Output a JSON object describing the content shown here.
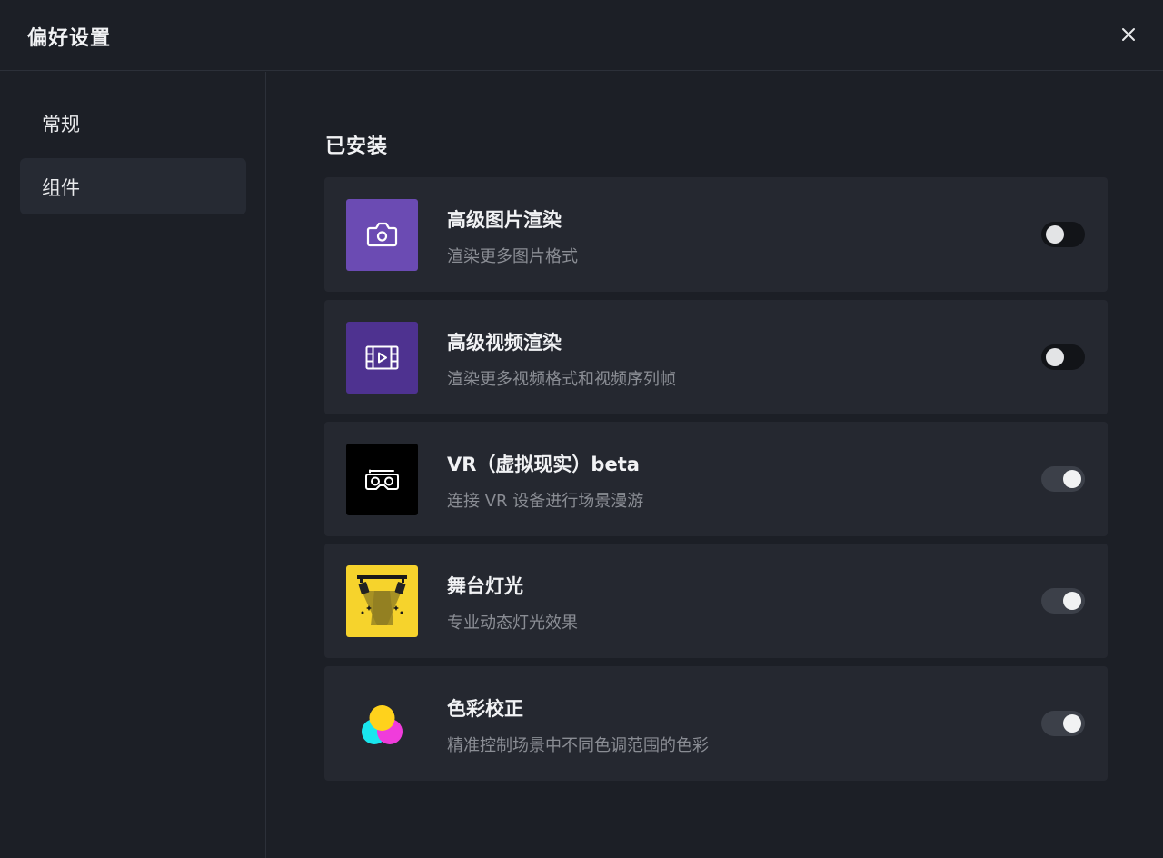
{
  "dialog": {
    "title": "偏好设置",
    "close_icon": "close-icon"
  },
  "sidebar": {
    "items": [
      {
        "label": "常规",
        "active": false
      },
      {
        "label": "组件",
        "active": true
      }
    ]
  },
  "main": {
    "section_title": "已安装",
    "plugins": [
      {
        "name": "高级图片渲染",
        "description": "渲染更多图片格式",
        "icon": "camera-icon",
        "icon_bg": "#6b4bb3",
        "enabled": false
      },
      {
        "name": "高级视频渲染",
        "description": "渲染更多视频格式和视频序列帧",
        "icon": "video-film-icon",
        "icon_bg": "#4e3290",
        "enabled": false
      },
      {
        "name": "VR（虚拟现实）beta",
        "description": "连接 VR 设备进行场景漫游",
        "icon": "vr-headset-icon",
        "icon_bg": "#000000",
        "enabled": true
      },
      {
        "name": "舞台灯光",
        "description": "专业动态灯光效果",
        "icon": "stage-light-icon",
        "icon_bg": "#f6d32c",
        "enabled": true
      },
      {
        "name": "色彩校正",
        "description": "精准控制场景中不同色调范围的色彩",
        "icon": "color-circles-icon",
        "icon_bg": "#252830",
        "enabled": true
      }
    ]
  },
  "colors": {
    "background": "#1c1f26",
    "card": "#252830",
    "toggle_off": "#121418",
    "toggle_on": "#3c4049"
  }
}
